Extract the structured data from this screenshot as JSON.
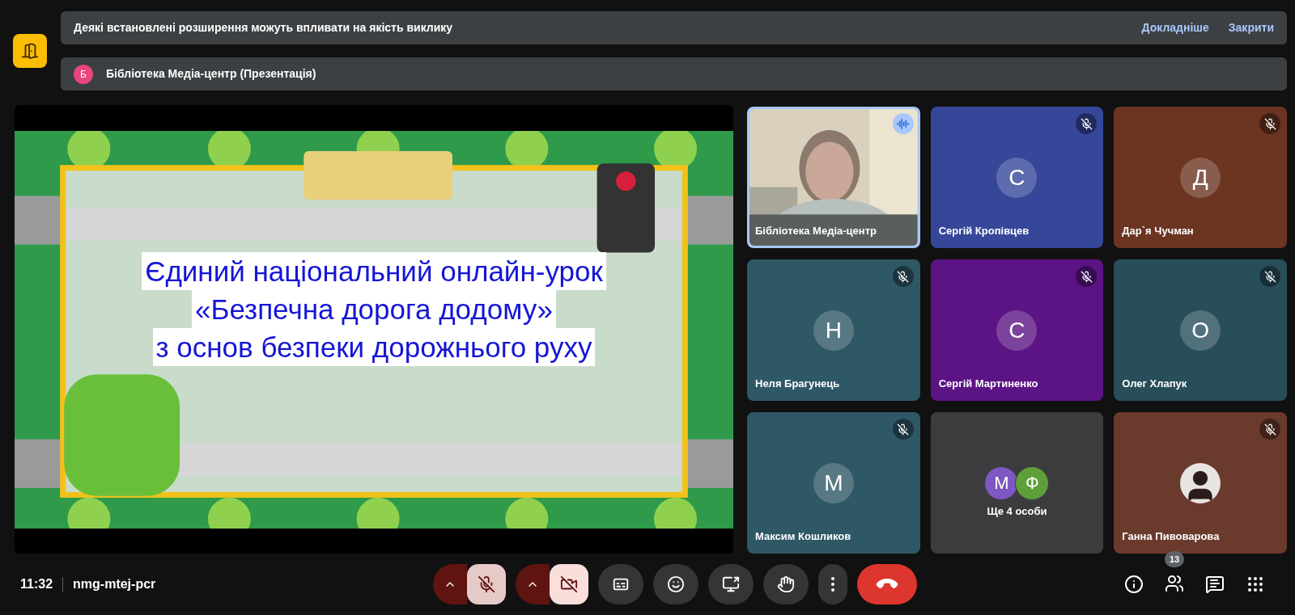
{
  "notices": [
    {
      "kind": "warning",
      "text": "Деякі встановлені розширення можуть впливати на якість виклику",
      "actions": [
        "Докладніше",
        "Закрити"
      ]
    },
    {
      "kind": "presenter",
      "avatar": "Б",
      "text": "Бібліотека Медіа-центр (Презентація)"
    }
  ],
  "presentation": {
    "lines": [
      "Єдиний національний онлайн-урок",
      "«Безпечна дорога додому»",
      "з основ безпеки дорожнього руху"
    ]
  },
  "tiles": [
    {
      "kind": "video",
      "name": "Бібліотека Медіа-центр",
      "muted": false,
      "selected": true
    },
    {
      "kind": "avatar",
      "name": "Сергій Кропівцев",
      "initial": "С",
      "muted": true,
      "selected": false,
      "color": "#36479a"
    },
    {
      "kind": "avatar",
      "name": "Дар`я Чучман",
      "initial": "Д",
      "muted": true,
      "selected": false,
      "color": "#6b3522"
    },
    {
      "kind": "avatar",
      "name": "Неля Брагунець",
      "initial": "Н",
      "muted": true,
      "selected": false,
      "color": "#2f5866"
    },
    {
      "kind": "avatar",
      "name": "Сергій Мартиненко",
      "initial": "С",
      "muted": true,
      "selected": false,
      "color": "#5c1485"
    },
    {
      "kind": "avatar",
      "name": "Олег Хлапук",
      "initial": "О",
      "muted": true,
      "selected": false,
      "color": "#284e5a"
    },
    {
      "kind": "avatar",
      "name": "Максим Кошликов",
      "initial": "М",
      "muted": true,
      "selected": false,
      "color": "#2f5866"
    },
    {
      "kind": "more",
      "text": "Ще 4 особи",
      "avatars": [
        {
          "initial": "М",
          "color": "#7e57c2"
        },
        {
          "initial": "Ф",
          "color": "#5e9f3a"
        }
      ]
    },
    {
      "name": "Ганна Пивоварова",
      "muted": true,
      "selected": false,
      "color": "#6a3a2c"
    }
  ],
  "meeting": {
    "time": "11:32",
    "code": "nmg-mtej-pcr"
  },
  "controls": [
    {
      "kind": "mic",
      "on": false
    },
    {
      "kind": "camera",
      "on": false
    },
    {
      "kind": "captions"
    },
    {
      "kind": "emoji"
    },
    {
      "kind": "present"
    },
    {
      "kind": "hand"
    },
    {
      "kind": "more"
    },
    {
      "kind": "end"
    }
  ],
  "side_buttons": [
    {
      "kind": "info"
    },
    {
      "kind": "people",
      "badge": "13"
    },
    {
      "kind": "chat"
    },
    {
      "kind": "activities"
    }
  ]
}
